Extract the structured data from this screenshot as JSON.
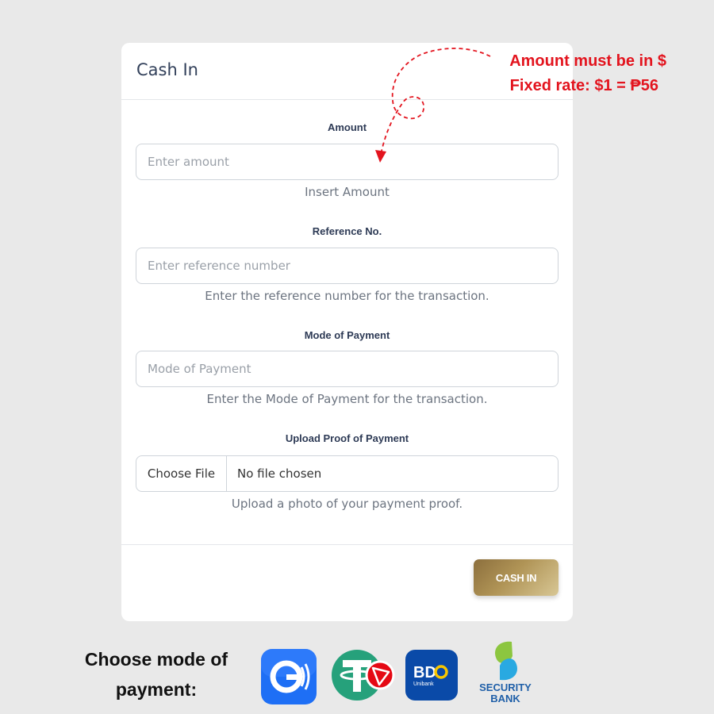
{
  "annotation": {
    "line1": "Amount must be in  $",
    "line2": "Fixed rate: $1 = ₱56"
  },
  "card": {
    "title": "Cash In",
    "amount": {
      "label": "Amount",
      "placeholder": "Enter amount",
      "help": "Insert Amount"
    },
    "reference": {
      "label": "Reference No.",
      "placeholder": "Enter reference number",
      "help": "Enter the reference number for the transaction."
    },
    "mode": {
      "label": "Mode of Payment",
      "placeholder": "Mode of Payment",
      "help": "Enter the Mode of Payment for the transaction."
    },
    "upload": {
      "label": "Upload Proof of Payment",
      "button": "Choose File",
      "file_status": "No file chosen",
      "help": "Upload a photo of your payment proof."
    },
    "submit_label": "CASH IN"
  },
  "payment_section": {
    "title": "Choose mode of payment:",
    "logos": [
      {
        "icon": "gcash-logo",
        "color": "#1e6ff5"
      },
      {
        "icon": "tether-tron-logo",
        "color": "#26a17b"
      },
      {
        "icon": "bdo-logo",
        "text": "BDO",
        "subtext": "Unibank",
        "color": "#0a4aa8"
      },
      {
        "icon": "security-bank-logo",
        "text": "SECURITY",
        "subtext": "BANK",
        "color": "#1f5fa8"
      }
    ]
  },
  "colors": {
    "accent_red": "#e3141e",
    "gold": "#b09456",
    "title_navy": "#32405a"
  }
}
